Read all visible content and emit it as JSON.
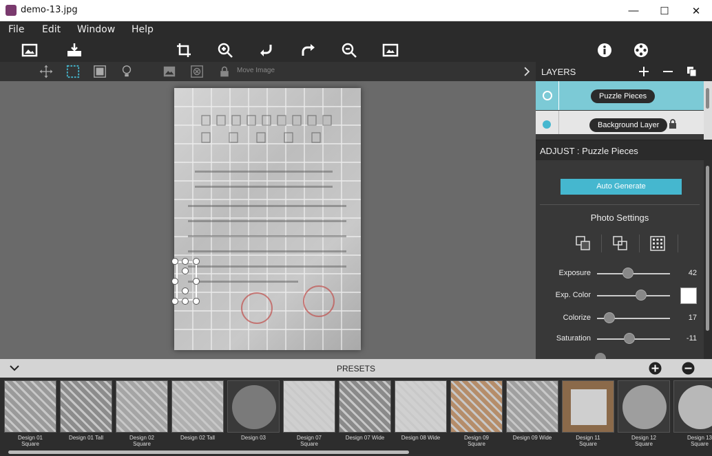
{
  "window": {
    "title": "demo-13.jpg",
    "minimize": "—",
    "maximize": "☐",
    "close": "✕"
  },
  "menu": {
    "file": "File",
    "edit": "Edit",
    "window": "Window",
    "help": "Help"
  },
  "toolbar": {
    "move_image_label": "Move Image"
  },
  "layers": {
    "header": "LAYERS",
    "items": [
      {
        "label": "Puzzle Pieces"
      },
      {
        "label": "Background Layer"
      }
    ]
  },
  "adjust": {
    "header": "ADJUST : Puzzle Pieces",
    "auto_generate": "Auto Generate",
    "photo_settings": "Photo Settings",
    "settings": [
      {
        "label": "Exposure",
        "value": "42",
        "level": 0.42
      },
      {
        "label": "Exp. Color",
        "value": "",
        "level": 0.6
      },
      {
        "label": "Colorize",
        "value": "17",
        "level": 0.17
      },
      {
        "label": "Saturation",
        "value": "-11",
        "level": 0.44
      }
    ],
    "swatch_color": "#ffffff"
  },
  "presets": {
    "header": "PRESETS",
    "items": [
      {
        "line1": "Design 01",
        "line2": "Square"
      },
      {
        "line1": "Design 01 Tall",
        "line2": ""
      },
      {
        "line1": "Design 02",
        "line2": "Square"
      },
      {
        "line1": "Design 02 Tall",
        "line2": ""
      },
      {
        "line1": "Design 03",
        "line2": ""
      },
      {
        "line1": "Design 07",
        "line2": "Square"
      },
      {
        "line1": "Design 07 Wide",
        "line2": ""
      },
      {
        "line1": "Design 08 Wide",
        "line2": ""
      },
      {
        "line1": "Design 09",
        "line2": "Square"
      },
      {
        "line1": "Design 09 Wide",
        "line2": ""
      },
      {
        "line1": "Design 11",
        "line2": "Square"
      },
      {
        "line1": "Design 12",
        "line2": "Square"
      },
      {
        "line1": "Design 13",
        "line2": "Square"
      }
    ]
  },
  "colors": {
    "accent": "#45b7cf",
    "layer_selected": "#7ccad6"
  }
}
